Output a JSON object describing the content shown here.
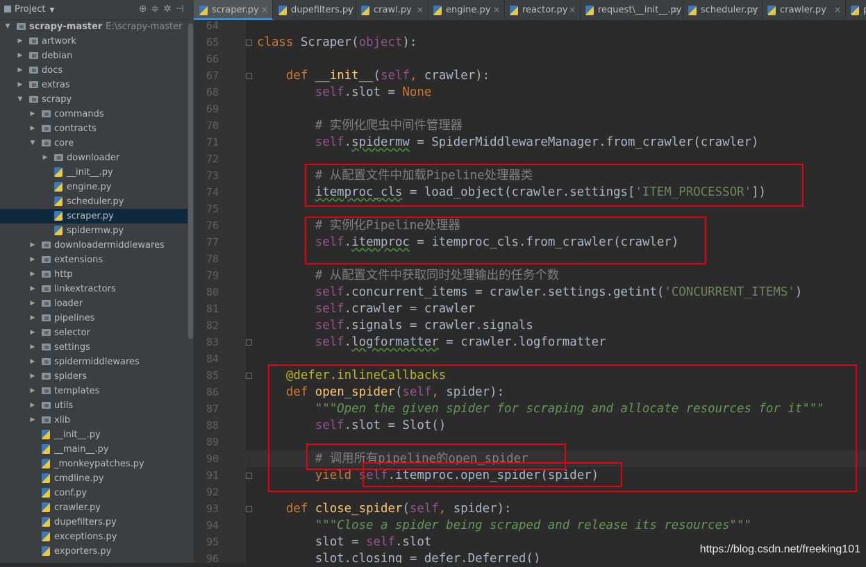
{
  "project_panel": {
    "title": "Project",
    "tree": [
      {
        "label": "scrapy-master",
        "extra": "E:\\scrapy-master",
        "kind": "folder",
        "expanded": true
      },
      {
        "label": "artwork",
        "kind": "folder"
      },
      {
        "label": "debian",
        "kind": "folder"
      },
      {
        "label": "docs",
        "kind": "folder"
      },
      {
        "label": "extras",
        "kind": "folder"
      },
      {
        "label": "scrapy",
        "kind": "folder",
        "expanded": true
      },
      {
        "label": "commands",
        "kind": "folder"
      },
      {
        "label": "contracts",
        "kind": "folder"
      },
      {
        "label": "core",
        "kind": "folder",
        "expanded": true
      },
      {
        "label": "downloader",
        "kind": "folder"
      },
      {
        "label": "__init__.py",
        "kind": "file"
      },
      {
        "label": "engine.py",
        "kind": "file"
      },
      {
        "label": "scheduler.py",
        "kind": "file"
      },
      {
        "label": "scraper.py",
        "kind": "file",
        "selected": true
      },
      {
        "label": "spidermw.py",
        "kind": "file"
      },
      {
        "label": "downloadermiddlewares",
        "kind": "folder"
      },
      {
        "label": "extensions",
        "kind": "folder"
      },
      {
        "label": "http",
        "kind": "folder"
      },
      {
        "label": "linkextractors",
        "kind": "folder"
      },
      {
        "label": "loader",
        "kind": "folder"
      },
      {
        "label": "pipelines",
        "kind": "folder"
      },
      {
        "label": "selector",
        "kind": "folder"
      },
      {
        "label": "settings",
        "kind": "folder"
      },
      {
        "label": "spidermiddlewares",
        "kind": "folder"
      },
      {
        "label": "spiders",
        "kind": "folder"
      },
      {
        "label": "templates",
        "kind": "folder"
      },
      {
        "label": "utils",
        "kind": "folder"
      },
      {
        "label": "xlib",
        "kind": "folder"
      },
      {
        "label": "__init__.py",
        "kind": "file"
      },
      {
        "label": "__main__.py",
        "kind": "file"
      },
      {
        "label": "_monkeypatches.py",
        "kind": "file"
      },
      {
        "label": "cmdline.py",
        "kind": "file"
      },
      {
        "label": "conf.py",
        "kind": "file"
      },
      {
        "label": "crawler.py",
        "kind": "file"
      },
      {
        "label": "dupefilters.py",
        "kind": "file"
      },
      {
        "label": "exceptions.py",
        "kind": "file"
      },
      {
        "label": "exporters.py",
        "kind": "file"
      }
    ]
  },
  "tabs": [
    {
      "label": "scraper.py",
      "active": true
    },
    {
      "label": "dupefilters.py"
    },
    {
      "label": "crawl.py"
    },
    {
      "label": "engine.py"
    },
    {
      "label": "reactor.py"
    },
    {
      "label": "request\\__init__.py"
    },
    {
      "label": "scheduler.py"
    },
    {
      "label": "crawler.py"
    },
    {
      "label": "p"
    }
  ],
  "tab_close_glyph": "×",
  "editor": {
    "current_line": 90,
    "lines": [
      {
        "n": 64,
        "t": []
      },
      {
        "n": 65,
        "t": [
          [
            "k",
            "class "
          ],
          [
            "",
            "Scraper("
          ],
          [
            "s",
            "object"
          ],
          [
            "",
            "):"
          ]
        ]
      },
      {
        "n": 66,
        "t": []
      },
      {
        "n": 67,
        "t": [
          [
            "",
            "    "
          ],
          [
            "k",
            "def "
          ],
          [
            "f",
            "__init__"
          ],
          [
            "",
            "("
          ],
          [
            "s",
            "self"
          ],
          [
            "k",
            ", "
          ],
          [
            "",
            "crawler):"
          ]
        ]
      },
      {
        "n": 68,
        "t": [
          [
            "",
            "        "
          ],
          [
            "s",
            "self"
          ],
          [
            "",
            ".slot = "
          ],
          [
            "k",
            "None"
          ]
        ]
      },
      {
        "n": 69,
        "t": []
      },
      {
        "n": 70,
        "t": [
          [
            "c",
            "        # 实例化爬虫中间件管理器"
          ]
        ]
      },
      {
        "n": 71,
        "t": [
          [
            "",
            "        "
          ],
          [
            "s",
            "self"
          ],
          [
            "",
            "."
          ],
          [
            "u",
            "spidermw"
          ],
          [
            "",
            " = SpiderMiddlewareManager.from_crawler(crawler)"
          ]
        ]
      },
      {
        "n": 72,
        "t": []
      },
      {
        "n": 73,
        "t": [
          [
            "c",
            "        # 从配置文件中加载Pipeline处理器类"
          ]
        ]
      },
      {
        "n": 74,
        "t": [
          [
            "",
            "        "
          ],
          [
            "u",
            "itemproc_cls"
          ],
          [
            "",
            " = load_object(crawler.settings["
          ],
          [
            "st",
            "'ITEM_PROCESSOR'"
          ],
          [
            "",
            "])"
          ]
        ]
      },
      {
        "n": 75,
        "t": []
      },
      {
        "n": 76,
        "t": [
          [
            "c",
            "        # 实例化Pipeline处理器"
          ]
        ]
      },
      {
        "n": 77,
        "t": [
          [
            "",
            "        "
          ],
          [
            "s",
            "self"
          ],
          [
            "",
            "."
          ],
          [
            "u",
            "itemproc"
          ],
          [
            "",
            " = itemproc_cls.from_crawler(crawler)"
          ]
        ]
      },
      {
        "n": 78,
        "t": []
      },
      {
        "n": 79,
        "t": [
          [
            "c",
            "        # 从配置文件中获取同时处理输出的任务个数"
          ]
        ]
      },
      {
        "n": 80,
        "t": [
          [
            "",
            "        "
          ],
          [
            "s",
            "self"
          ],
          [
            "",
            ".concurrent_items = crawler.settings.getint("
          ],
          [
            "st",
            "'CONCURRENT_ITEMS'"
          ],
          [
            "",
            ")"
          ]
        ]
      },
      {
        "n": 81,
        "t": [
          [
            "",
            "        "
          ],
          [
            "s",
            "self"
          ],
          [
            "",
            ".crawler = crawler"
          ]
        ]
      },
      {
        "n": 82,
        "t": [
          [
            "",
            "        "
          ],
          [
            "s",
            "self"
          ],
          [
            "",
            ".signals = crawler.signals"
          ]
        ]
      },
      {
        "n": 83,
        "t": [
          [
            "",
            "        "
          ],
          [
            "s",
            "self"
          ],
          [
            "",
            "."
          ],
          [
            "u",
            "logformatter"
          ],
          [
            "",
            " = crawler.logformatter"
          ]
        ]
      },
      {
        "n": 84,
        "t": []
      },
      {
        "n": 85,
        "t": [
          [
            "",
            "    "
          ],
          [
            "dec",
            "@defer.inlineCallbacks"
          ]
        ]
      },
      {
        "n": 86,
        "t": [
          [
            "",
            "    "
          ],
          [
            "k",
            "def "
          ],
          [
            "f",
            "open_spider"
          ],
          [
            "",
            "("
          ],
          [
            "s",
            "self"
          ],
          [
            "k",
            ", "
          ],
          [
            "",
            "spider):"
          ]
        ]
      },
      {
        "n": 87,
        "t": [
          [
            "",
            "        "
          ],
          [
            "doc",
            "\"\"\"Open the given spider for scraping and allocate resources for it\"\"\""
          ]
        ]
      },
      {
        "n": 88,
        "t": [
          [
            "",
            "        "
          ],
          [
            "s",
            "self"
          ],
          [
            "",
            ".slot = Slot()"
          ]
        ]
      },
      {
        "n": 89,
        "t": []
      },
      {
        "n": 90,
        "t": [
          [
            "c",
            "        # 调用所有pipeline的open_spider"
          ]
        ]
      },
      {
        "n": 91,
        "t": [
          [
            "",
            "        "
          ],
          [
            "k",
            "yield "
          ],
          [
            "s",
            "self"
          ],
          [
            "",
            ".itemproc.open_spider(spider)"
          ]
        ]
      },
      {
        "n": 92,
        "t": []
      },
      {
        "n": 93,
        "t": [
          [
            "",
            "    "
          ],
          [
            "k",
            "def "
          ],
          [
            "f",
            "close_spider"
          ],
          [
            "",
            "("
          ],
          [
            "s",
            "self"
          ],
          [
            "k",
            ", "
          ],
          [
            "",
            "spider):"
          ]
        ]
      },
      {
        "n": 94,
        "t": [
          [
            "",
            "        "
          ],
          [
            "doc",
            "\"\"\"Close a spider being scraped and release its resources\"\"\""
          ]
        ]
      },
      {
        "n": 95,
        "t": [
          [
            "",
            "        "
          ],
          [
            "",
            "slot = "
          ],
          [
            "s",
            "self"
          ],
          [
            "",
            ".slot"
          ]
        ]
      },
      {
        "n": 96,
        "t": [
          [
            "",
            "        "
          ],
          [
            "",
            "slot.closing = defer.Deferred()"
          ]
        ]
      }
    ]
  },
  "colors": {
    "annotation_box": "#e60012",
    "keyword": "#cc7832",
    "self": "#94558d",
    "function": "#ffc66d",
    "comment": "#808080",
    "string": "#6a8759",
    "docstring": "#629755",
    "decorator": "#bbb529"
  },
  "watermark": "https://blog.csdn.net/freeking101"
}
